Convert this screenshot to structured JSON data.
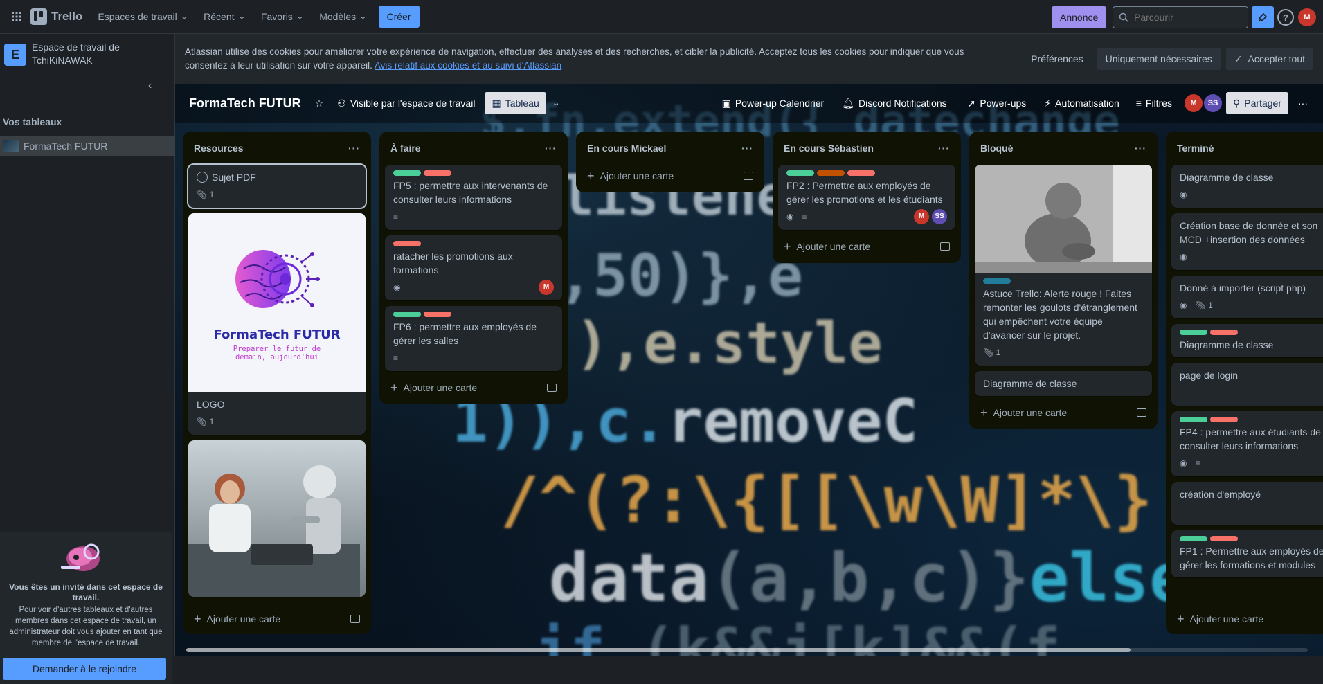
{
  "topbar": {
    "app_name": "Trello",
    "nav": [
      "Espaces de travail",
      "Récent",
      "Favoris",
      "Modèles"
    ],
    "create_label": "Créer",
    "annonce_label": "Annonce",
    "search_placeholder": "Parcourir",
    "user_initial": "M"
  },
  "sidebar": {
    "workspace_initial": "E",
    "workspace_name": "Espace de travail de TchiKiNAWAK",
    "section_title": "Vos tableaux",
    "boards": [
      "FormaTech FUTUR"
    ],
    "invite_title": "Vous êtes un invité dans cet espace de travail.",
    "invite_text": "Pour voir d'autres tableaux et d'autres membres dans cet espace de travail, un administrateur doit vous ajouter en tant que membre de l'espace de travail.",
    "join_label": "Demander à le rejoindre"
  },
  "cookie": {
    "text": "Atlassian utilise des cookies pour améliorer votre expérience de navigation, effectuer des analyses et des recherches, et cibler la publicité. Acceptez tous les cookies pour indiquer que vous consentez à leur utilisation sur votre appareil.",
    "link": "Avis relatif aux cookies et au suivi d'Atlassian",
    "pref_label": "Préférences",
    "necessary_label": "Uniquement nécessaires",
    "accept_label": "Accepter tout"
  },
  "board": {
    "title": "FormaTech FUTUR",
    "visibility": "Visible par l'espace de travail",
    "view_tab": "Tableau",
    "powerup_calendar": "Power-up Calendrier",
    "discord": "Discord Notifications",
    "powerups": "Power-ups",
    "automation": "Automatisation",
    "filters": "Filtres",
    "share": "Partager",
    "members": [
      "M",
      "SS"
    ],
    "add_card": "Ajouter une carte"
  },
  "logo_card": {
    "brand": "FormaTech FUTUR",
    "tagline_1": "Preparer le futur de",
    "tagline_2": "demain, aujourd'hui"
  },
  "colors": {
    "green": "#4bce97",
    "red": "#f87168",
    "orange": "#c25100",
    "blue": "#227d9b",
    "accent": "#579dff"
  },
  "lists": [
    {
      "title": "Resources",
      "cards": [
        {
          "title": "Sujet PDF",
          "attachments": "1"
        },
        {
          "title": "LOGO",
          "attachments": "1"
        },
        {
          "title": ""
        }
      ]
    },
    {
      "title": "À faire",
      "cards": [
        {
          "title": "FP5 : permettre aux intervenants de consulter leurs informations"
        },
        {
          "title": "ratacher les promotions aux formations",
          "member": "M"
        },
        {
          "title": "FP6 : permettre aux employés de gérer les salles"
        }
      ]
    },
    {
      "title": "En cours Mickael",
      "cards": []
    },
    {
      "title": "En cours Sébastien",
      "cards": [
        {
          "title": "FP2 : Permettre aux employés de gérer les promotions et les étudiants",
          "members": [
            "M",
            "SS"
          ]
        }
      ]
    },
    {
      "title": "Bloqué",
      "cards": [
        {
          "title": "Astuce Trello: Alerte rouge ! Faites remonter les goulots d'étranglement qui empêchent votre équipe d'avancer sur le projet.",
          "attachments": "1"
        },
        {
          "title": "Diagramme de classe"
        }
      ]
    },
    {
      "title": "Terminé",
      "cards": [
        {
          "title": "Diagramme de classe"
        },
        {
          "title": "Création base de donnée et son MCD +insertion des données"
        },
        {
          "title": "Donné à importer (script php)",
          "attachments": "1"
        },
        {
          "title": "Diagramme de classe"
        },
        {
          "title": "page de login"
        },
        {
          "title": "FP4 : permettre aux étudiants de consulter leurs informations"
        },
        {
          "title": "création d'employé"
        },
        {
          "title": "FP1 : Permettre aux employés de gérer les formations et modules"
        }
      ]
    }
  ]
}
